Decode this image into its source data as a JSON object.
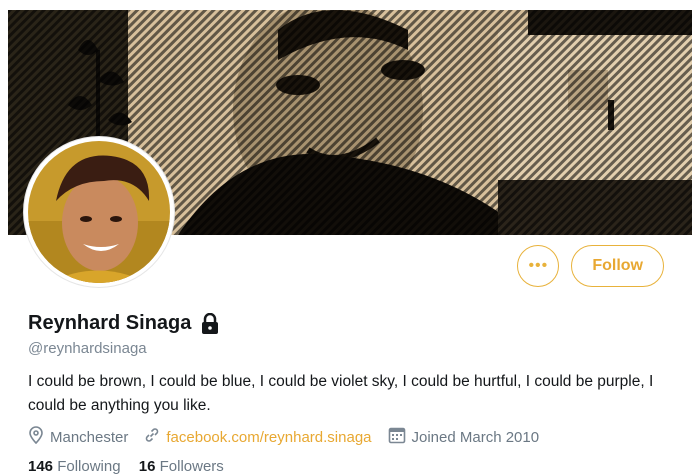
{
  "profile": {
    "name": "Reynhard Sinaga",
    "handle": "@reynhardsinaga",
    "bio": "I could be brown, I could be blue, I could be violet sky, I could be hurtful, I could be purple, I could be anything you like.",
    "location": "Manchester",
    "website": "facebook.com/reynhard.sinaga",
    "joined": "Joined March 2010",
    "protected": true
  },
  "actions": {
    "more_label": "•••",
    "follow_label": "Follow"
  },
  "counts": {
    "following_value": "146",
    "following_label": "Following",
    "followers_value": "16",
    "followers_label": "Followers"
  },
  "colors": {
    "accent": "#e8a832",
    "text": "#14171a",
    "muted": "#6b7884"
  },
  "icons": {
    "location": "map-pin-icon",
    "link": "link-icon",
    "joined": "calendar-icon",
    "lock": "lock-icon"
  }
}
